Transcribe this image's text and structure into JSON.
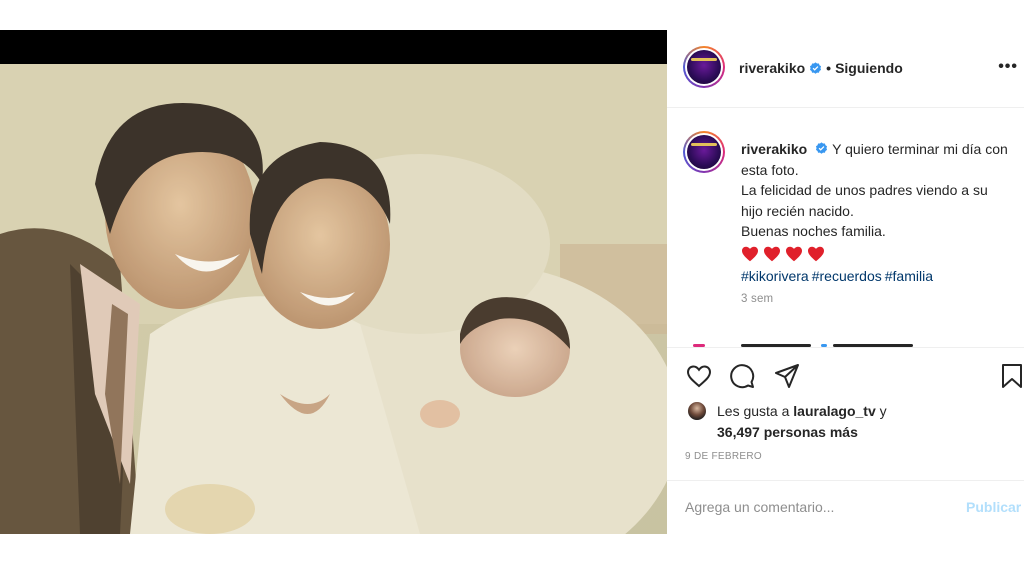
{
  "post": {
    "username": "riverakiko",
    "follow_state": "Siguiendo",
    "separator": "•",
    "more": "•••",
    "caption_lines": [
      "Y quiero terminar mi día con esta foto.",
      "La felicidad de unos padres viendo a su hijo recién nacido.",
      "Buenas noches familia."
    ],
    "hearts": 4,
    "hashtags": [
      "#kikorivera",
      "#recuerdos",
      "#familia"
    ],
    "age": "3 sem",
    "likes_prefix": "Les gusta a",
    "liked_by": "lauralago_tv",
    "likes_suffix": "y",
    "likes_count": "36,497 personas más",
    "date": "9 DE FEBRERO",
    "comment_placeholder": "Agrega un comentario...",
    "publish_label": "Publicar"
  },
  "colors": {
    "link": "#00376b",
    "verified": "#3897f0",
    "heart": "#e0202b",
    "publish_disabled": "#b2dffc",
    "muted": "#8e8e8e"
  },
  "icons": [
    "verified-badge-icon",
    "heart-icon",
    "comment-icon",
    "share-icon",
    "bookmark-icon",
    "more-options-icon"
  ]
}
